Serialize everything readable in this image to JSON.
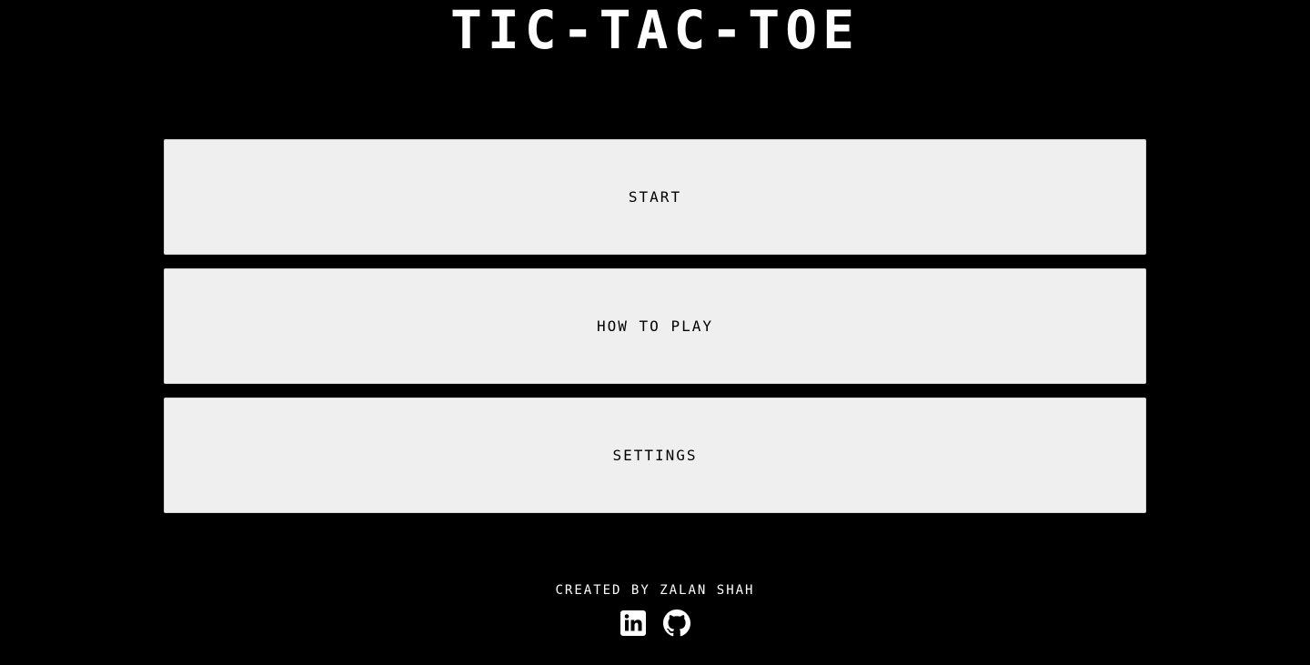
{
  "header": {
    "title": "TIC-TAC-TOE"
  },
  "menu": {
    "start_label": "START",
    "how_to_play_label": "HOW TO PLAY",
    "settings_label": "SETTINGS"
  },
  "footer": {
    "credit": "CREATED BY ZALAN SHAH",
    "social_icons": [
      "linkedin-icon",
      "github-icon"
    ]
  },
  "colors": {
    "background": "#000000",
    "button_background": "#efefef",
    "text_light": "#ffffff",
    "text_dark": "#000000"
  }
}
